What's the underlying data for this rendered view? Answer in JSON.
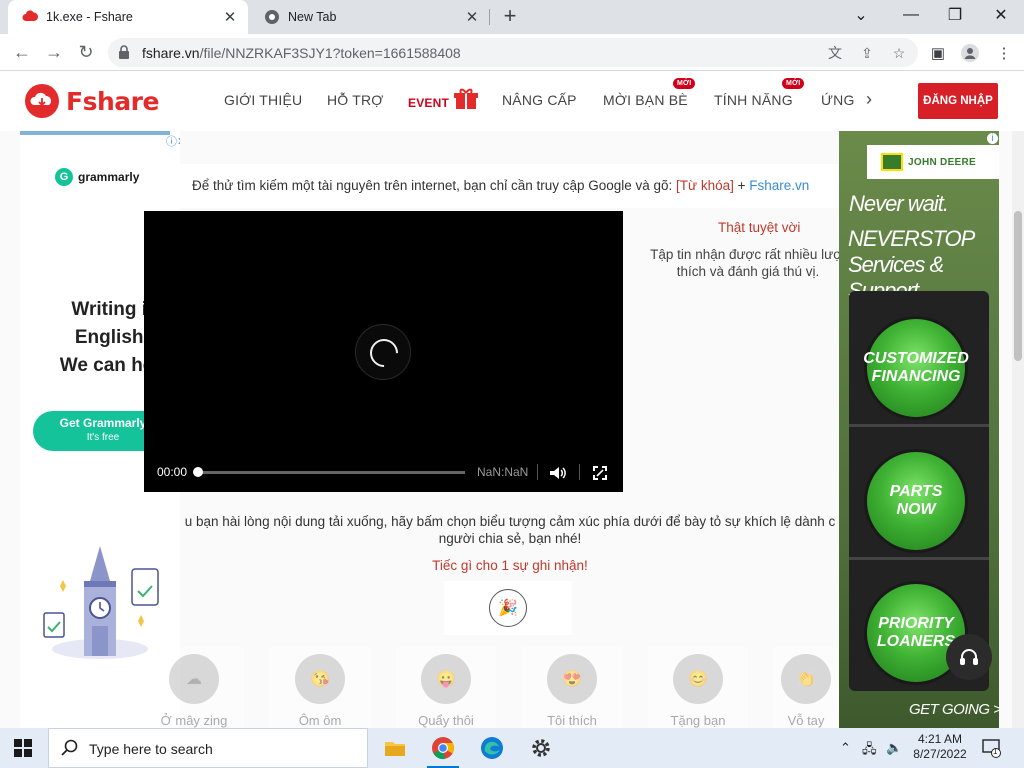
{
  "browser": {
    "tabs": [
      {
        "title": "1k.exe - Fshare",
        "active": true
      },
      {
        "title": "New Tab",
        "active": false
      }
    ],
    "url_host": "fshare.vn",
    "url_path": "/file/NNZRKAF3SJY1?token=1661588408"
  },
  "site": {
    "logo_text": "Fshare",
    "nav": [
      "GIỚI THIỆU",
      "HỖ TRỢ",
      "EVENT",
      "NÂNG CẤP",
      "MỜI BẠN BÈ",
      "TÍNH NĂNG",
      "ỨNG"
    ],
    "badge": "MỚI",
    "login": "ĐĂNG NHẬP"
  },
  "content": {
    "tip_prefix": "Để thử tìm kiếm một tài nguyên trên internet, bạn chỉ cần truy cập Google và gõ: ",
    "tip_keyword": "[Từ khóa]",
    "tip_plus": " + ",
    "tip_site": "Fshare.vn",
    "awesome": "Thật tuyệt vời",
    "desc": "Tập tin nhận được rất nhiều lượt thích và đánh giá thú vị.",
    "hint_line1": "u bạn hài lòng nội dung tải xuống, hãy bấm chọn biểu tượng cảm xúc phía dưới để bày tỏ sự khích lệ dành c",
    "hint_line2": "người chia sẻ, bạn nhé!",
    "record": "Tiếc gì cho 1 sự ghi nhận!",
    "reactions": [
      "Ở mây zing",
      "Ôm ôm",
      "Quẩy thôi",
      "Tôi thích",
      "Tặng bạn",
      "Vỗ tay"
    ]
  },
  "ad_left": {
    "brand": "grammarly",
    "headline_1": "Writing in",
    "headline_2": "English?",
    "headline_3": "We can help",
    "cta": "Get Grammarly",
    "cta_sub": "It's free"
  },
  "ad_right": {
    "brand": "JOHN DEERE",
    "h1": "Never wait.",
    "h2a": "NEVERSTOP",
    "h2b": "Services & Support",
    "light1a": "CUSTOMIZED",
    "light1b": "FINANCING",
    "light2a": "PARTS",
    "light2b": "NOW",
    "light3a": "PRIORITY",
    "light3b": "LOANERS",
    "cta": "GET GOING >"
  },
  "video": {
    "current_time": "00:00",
    "duration": "NaN:NaN",
    "progress": 0
  },
  "taskbar": {
    "search_placeholder": "Type here to search",
    "time": "4:21 AM",
    "date": "8/27/2022",
    "notification_count": "1"
  },
  "colors": {
    "brand_red": "#e32b2b",
    "grammarly_green": "#15c39a",
    "jd_green": "#367c2b"
  }
}
